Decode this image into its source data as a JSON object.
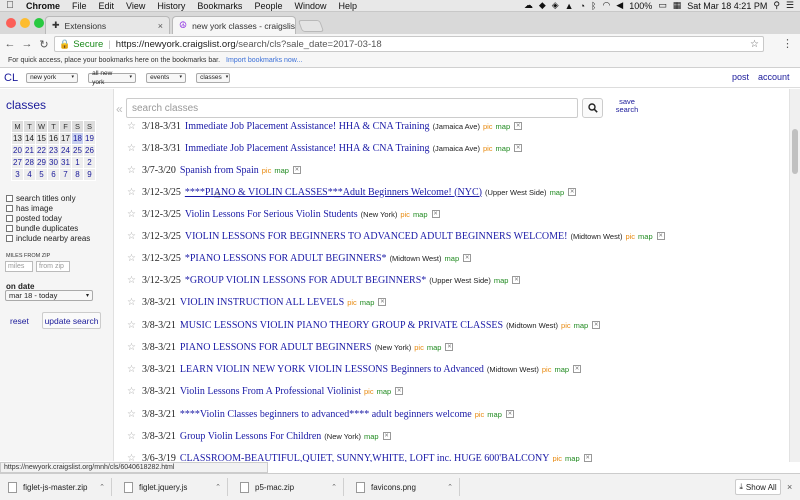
{
  "menubar": {
    "apple": "",
    "items": [
      "Chrome",
      "File",
      "Edit",
      "View",
      "History",
      "Bookmarks",
      "People",
      "Window",
      "Help"
    ],
    "battery": "100%",
    "datetime": "Sat Mar 18  4:21 PM"
  },
  "tabs": [
    {
      "title": "Extensions",
      "active": false
    },
    {
      "title": "new york classes - craigslist",
      "active": true
    }
  ],
  "omnibox": {
    "secure_label": "Secure",
    "url_host": "https://newyork.craigslist.org",
    "url_path": "/search/cls?sale_date=2017-03-18"
  },
  "bookmarks": {
    "hint": "For quick access, place your bookmarks here on the bookmarks bar.",
    "import_link": "Import bookmarks now..."
  },
  "clheader": {
    "logo": "CL",
    "selects": [
      "new york",
      "all new york",
      "events",
      "classes"
    ],
    "post": "post",
    "account": "account"
  },
  "sidebar": {
    "category": "classes",
    "calendar": {
      "headers": [
        "M",
        "T",
        "W",
        "T",
        "F",
        "S",
        "S"
      ],
      "weeks": [
        [
          "13",
          "14",
          "15",
          "16",
          "17",
          "18",
          "19"
        ],
        [
          "20",
          "21",
          "22",
          "23",
          "24",
          "25",
          "26"
        ],
        [
          "27",
          "28",
          "29",
          "30",
          "31",
          "1",
          "2"
        ],
        [
          "3",
          "4",
          "5",
          "6",
          "7",
          "8",
          "9"
        ]
      ],
      "today": "18"
    },
    "checkboxes": [
      "search titles only",
      "has image",
      "posted today",
      "bundle duplicates",
      "include nearby areas"
    ],
    "miles_label": "MILES FROM ZIP",
    "miles_placeholder": "miles",
    "zip_placeholder": "from zip",
    "on_date_label": "on date",
    "date_value": "mar 18 - today",
    "reset": "reset",
    "update": "update search"
  },
  "search": {
    "placeholder": "search classes",
    "save_label": "save search"
  },
  "results": [
    {
      "date": "3/18-3/31",
      "title": "Immediate Job Placement Assistance! HHA & CNA Training",
      "hood": "(Jamaica Ave)",
      "pic": "pic",
      "map": "map"
    },
    {
      "date": "3/18-3/31",
      "title": "Immediate Job Placement Assistance! HHA & CNA Training",
      "hood": "(Jamaica Ave)",
      "pic": "pic",
      "map": "map"
    },
    {
      "date": "3/7-3/20",
      "title": "Spanish from Spain",
      "hood": "",
      "pic": "pic",
      "map": "map"
    },
    {
      "date": "3/12-3/25",
      "title": "****PIANO & VIOLIN CLASSES***Adult Beginners Welcome! (NYC)",
      "hood": "(Upper West Side)",
      "pic": "",
      "map": "map",
      "underline": true
    },
    {
      "date": "3/12-3/25",
      "title": "Violin Lessons For Serious Violin Students",
      "hood": "(New York)",
      "pic": "pic",
      "map": "map"
    },
    {
      "date": "3/12-3/25",
      "title": "VIOLIN LESSONS FOR BEGINNERS TO ADVANCED ADULT BEGINNERS WELCOME!",
      "hood": "(Midtown West)",
      "pic": "pic",
      "map": "map"
    },
    {
      "date": "3/12-3/25",
      "title": "*PIANO LESSONS FOR ADULT BEGINNERS*",
      "hood": "(Midtown West)",
      "pic": "",
      "map": "map"
    },
    {
      "date": "3/12-3/25",
      "title": "*GROUP VIOLIN LESSONS FOR ADULT BEGINNERS*",
      "hood": "(Upper West Side)",
      "pic": "",
      "map": "map"
    },
    {
      "date": "3/8-3/21",
      "title": "VIOLIN INSTRUCTION ALL LEVELS",
      "hood": "",
      "pic": "pic",
      "map": "map"
    },
    {
      "date": "3/8-3/21",
      "title": "MUSIC LESSONS VIOLIN PIANO THEORY GROUP & PRIVATE CLASSES",
      "hood": "(Midtown West)",
      "pic": "pic",
      "map": "map"
    },
    {
      "date": "3/8-3/21",
      "title": "PIANO LESSONS FOR ADULT BEGINNERS",
      "hood": "(New York)",
      "pic": "pic",
      "map": "map"
    },
    {
      "date": "3/8-3/21",
      "title": "LEARN VIOLIN NEW YORK VIOLIN LESSONS Beginners to Advanced",
      "hood": "(Midtown West)",
      "pic": "pic",
      "map": "map"
    },
    {
      "date": "3/8-3/21",
      "title": "Violin Lessons From A Professional Violinist",
      "hood": "",
      "pic": "pic",
      "map": "map"
    },
    {
      "date": "3/8-3/21",
      "title": "****Violin Classes beginners to advanced**** adult beginners welcome",
      "hood": "",
      "pic": "pic",
      "map": "map"
    },
    {
      "date": "3/8-3/21",
      "title": "Group Violin Lessons For Children",
      "hood": "(New York)",
      "pic": "",
      "map": "map"
    },
    {
      "date": "3/6-3/19",
      "title": "CLASSROOM-BEAUTIFUL,QUIET, SUNNY,WHITE, LOFT inc. HUGE 600'BALCONY",
      "hood": "",
      "pic": "pic",
      "map": "map"
    }
  ],
  "status_url": "https://newyork.craigslist.org/mnh/cls/6040618282.html",
  "downloads": {
    "files": [
      "figlet-js-master.zip",
      "figlet.jquery.js",
      "p5-mac.zip",
      "favicons.png"
    ],
    "show_all": "Show All"
  }
}
